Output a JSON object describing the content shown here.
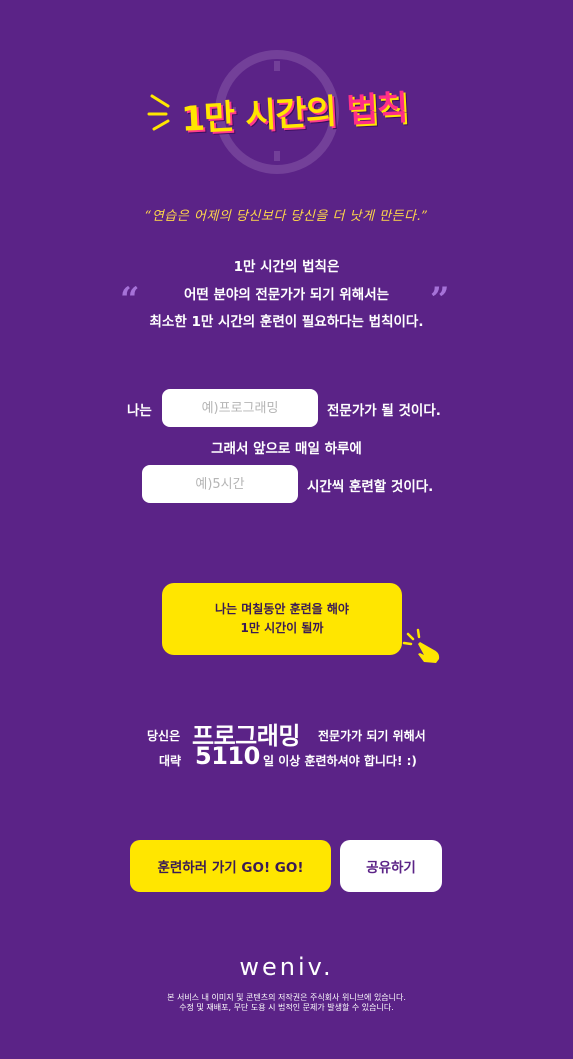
{
  "logo": {
    "title_part1": "1만 시간의 ",
    "title_part2": "법칙"
  },
  "quote": "“연습은 어제의 당신보다 당신을 더 낫게 만든다.”",
  "intro": {
    "line1": "1만 시간의 법칙은",
    "line2": "어떤 분야의 전문가가 되기 위해서는",
    "line3": "최소한 1만 시간의 훈련이 필요하다는 법칙이다.",
    "open_quote": "“",
    "close_quote": "”"
  },
  "form": {
    "prefix": "나는",
    "field_placeholder": "예)프로그래밍",
    "field_value": "",
    "suffix1": "전문가가 될 것이다.",
    "middle": "그래서 앞으로 매일 하루에",
    "hours_placeholder": "예)5시간",
    "hours_value": "",
    "suffix2": "시간씩 훈련할 것이다."
  },
  "calc_button": {
    "line1": "나는 며칠동안 훈련을 해야",
    "line2": "1만 시간이 될까"
  },
  "result": {
    "label1": "당신은",
    "field": "프로그래밍",
    "suffix1": "전문가가 되기 위해서",
    "label2": "대략",
    "days": "5110",
    "suffix2": "일 이상 훈련하셔야 합니다! :)"
  },
  "actions": {
    "go_label": "훈련하러 가기 GO! GO!",
    "share_label": "공유하기"
  },
  "brand": "weniv.",
  "footer": {
    "line1": "본 서비스 내 이미지 및 콘텐츠의 저작권은 주식회사 위니브에 있습니다.",
    "line2": "수정 및 재배포, 무단 도용 시 법적인 문제가 발생할 수 있습니다."
  },
  "colors": {
    "background": "#5B2387",
    "accent": "#FFE600",
    "highlight": "#FF2E88"
  }
}
